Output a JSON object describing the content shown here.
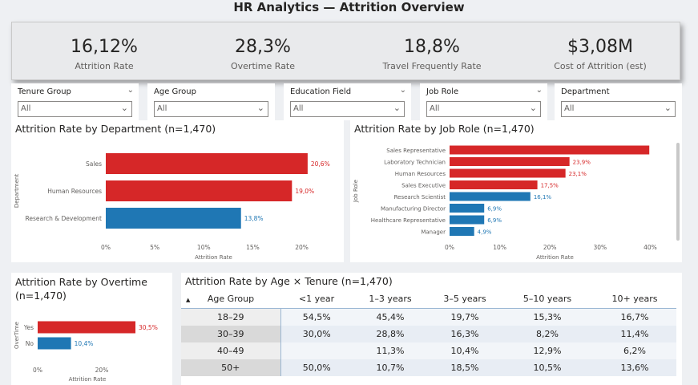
{
  "page": {
    "title": "HR Analytics — Attrition Overview"
  },
  "kpis": [
    {
      "value": "16,12%",
      "label": "Attrition Rate"
    },
    {
      "value": "28,3%",
      "label": "Overtime Rate"
    },
    {
      "value": "18,8%",
      "label": "Travel Frequently Rate"
    },
    {
      "value": "$3,08M",
      "label": "Cost of Attrition (est)"
    }
  ],
  "slicers": [
    {
      "label": "Tenure Group",
      "value": "All"
    },
    {
      "label": "Age Group",
      "value": "All"
    },
    {
      "label": "Education Field",
      "value": "All"
    },
    {
      "label": "Job Role",
      "value": "All"
    },
    {
      "label": "Department",
      "value": "All"
    }
  ],
  "panels": {
    "department": {
      "title": "Attrition Rate by Department (n=1,470)"
    },
    "jobrole": {
      "title": "Attrition Rate by Job Role (n=1,470)"
    },
    "overtime": {
      "title": "Attrition Rate by Overtime (n=1,470)"
    },
    "matrix": {
      "title": "Attrition Rate by Age × Tenure (n=1,470)"
    }
  },
  "colors": {
    "high": "#d62728",
    "low": "#1f77b4",
    "text_low": "#1f77b4",
    "text_high": "#d62728"
  },
  "chart_data": [
    {
      "type": "bar",
      "orientation": "horizontal",
      "title": "Attrition Rate by Department (n=1,470)",
      "xlabel": "Attrition Rate",
      "ylabel": "Department",
      "xlim": [
        0,
        22
      ],
      "xticks": [
        "0%",
        "5%",
        "10%",
        "15%",
        "20%"
      ],
      "xtick_values": [
        0,
        5,
        10,
        15,
        20
      ],
      "categories": [
        "Sales",
        "Human Resources",
        "Research & Development"
      ],
      "values": [
        20.6,
        19.0,
        13.8
      ],
      "labels": [
        "20,6%",
        "19,0%",
        "13,8%"
      ],
      "colors": [
        "high",
        "high",
        "low"
      ]
    },
    {
      "type": "bar",
      "orientation": "horizontal",
      "title": "Attrition Rate by Job Role (n=1,470)",
      "xlabel": "Attrition Rate",
      "ylabel": "Job Role",
      "xlim": [
        0,
        42
      ],
      "xticks": [
        "0%",
        "10%",
        "20%",
        "30%",
        "40%"
      ],
      "xtick_values": [
        0,
        10,
        20,
        30,
        40
      ],
      "categories": [
        "Sales Representative",
        "Laboratory Technician",
        "Human Resources",
        "Sales Executive",
        "Research Scientist",
        "Manufacturing Director",
        "Healthcare Representative",
        "Manager"
      ],
      "values": [
        39.8,
        23.9,
        23.1,
        17.5,
        16.1,
        6.9,
        6.9,
        4.9
      ],
      "labels": [
        "",
        "23,9%",
        "23,1%",
        "17,5%",
        "16,1%",
        "6,9%",
        "6,9%",
        "4,9%"
      ],
      "colors": [
        "high",
        "high",
        "high",
        "high",
        "low",
        "low",
        "low",
        "low"
      ]
    },
    {
      "type": "bar",
      "orientation": "horizontal",
      "title": "Attrition Rate by Overtime (n=1,470)",
      "xlabel": "Attrition Rate",
      "ylabel": "OverTime",
      "xlim": [
        0,
        31
      ],
      "xticks": [
        "0%",
        "20%"
      ],
      "xtick_values": [
        0,
        20
      ],
      "categories": [
        "Yes",
        "No"
      ],
      "values": [
        30.5,
        10.4
      ],
      "labels": [
        "30,5%",
        "10,4%"
      ],
      "colors": [
        "high",
        "low"
      ]
    },
    {
      "type": "table",
      "title": "Attrition Rate by Age × Tenure (n=1,470)",
      "row_header": "Age Group",
      "columns": [
        "<1 year",
        "1–3 years",
        "3–5 years",
        "5–10 years",
        "10+ years"
      ],
      "rows": [
        {
          "label": "18–29",
          "cells": [
            "54,5%",
            "45,4%",
            "19,7%",
            "15,3%",
            "16,7%"
          ]
        },
        {
          "label": "30–39",
          "cells": [
            "30,0%",
            "28,8%",
            "16,3%",
            "8,2%",
            "11,4%"
          ]
        },
        {
          "label": "40–49",
          "cells": [
            "",
            "11,3%",
            "10,4%",
            "12,9%",
            "6,2%"
          ]
        },
        {
          "label": "50+",
          "cells": [
            "50,0%",
            "10,7%",
            "18,5%",
            "10,5%",
            "13,6%"
          ]
        }
      ]
    }
  ]
}
